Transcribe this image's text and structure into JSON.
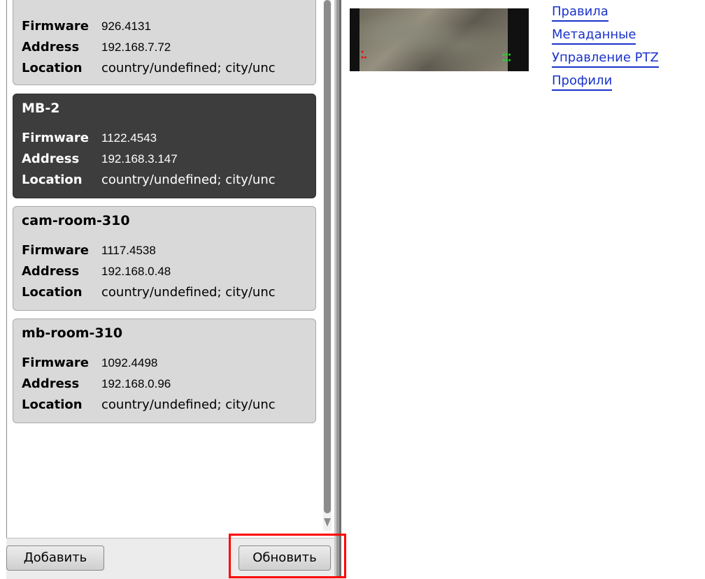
{
  "devices": [
    {
      "name": "",
      "firmware_label": "Firmware",
      "firmware": "926.4131",
      "address_label": "Address",
      "address": "192.168.7.72",
      "location_label": "Location",
      "location": "country/undefined; city/unc"
    },
    {
      "name": "MB-2",
      "firmware_label": "Firmware",
      "firmware": "1122.4543",
      "address_label": "Address",
      "address": "192.168.3.147",
      "location_label": "Location",
      "location": "country/undefined; city/unc"
    },
    {
      "name": "cam-room-310",
      "firmware_label": "Firmware",
      "firmware": "1117.4538",
      "address_label": "Address",
      "address": "192.168.0.48",
      "location_label": "Location",
      "location": "country/undefined; city/unc"
    },
    {
      "name": "mb-room-310",
      "firmware_label": "Firmware",
      "firmware": "1092.4498",
      "address_label": "Address",
      "address": "192.168.0.96",
      "location_label": "Location",
      "location": "country/undefined; city/unc"
    }
  ],
  "selected_device": "MB-2",
  "buttons": {
    "add": "Добавить",
    "refresh": "Обновить"
  },
  "nav_links": [
    "Правила",
    "Метаданные",
    "Управление PTZ",
    "Профили"
  ],
  "colors": {
    "link": "#1a33cc",
    "selected_card": "#3d3d3d",
    "card": "#d9d9d9",
    "highlight": "#ff0000"
  }
}
